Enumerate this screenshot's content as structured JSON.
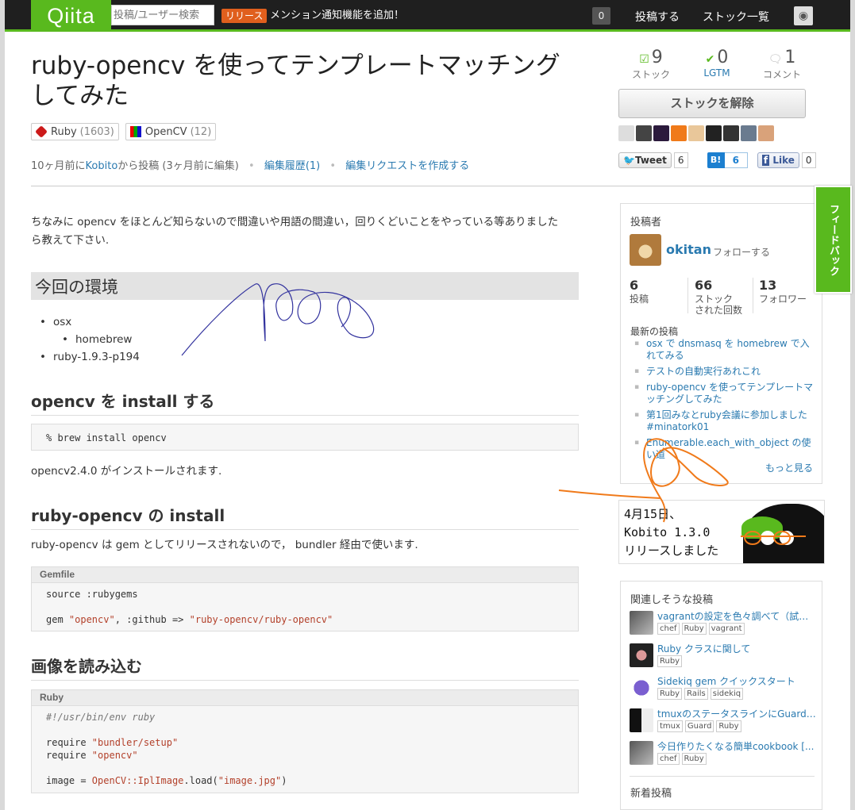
{
  "topbar": {
    "logo": "Qiita",
    "search_placeholder": "投稿/ユーザー検索",
    "release_tag": "リリース",
    "release_text": "メンション通知機能を追加！",
    "notification_count": "0",
    "nav_post": "投稿する",
    "nav_stock_list": "ストック一覧"
  },
  "article": {
    "title_line1": "ruby-opencv を使ってテンプレートマッチング",
    "title_line2": "してみた",
    "tags": [
      {
        "name": "Ruby",
        "count": "(1603)"
      },
      {
        "name": "OpenCV",
        "count": "(12)"
      }
    ],
    "meta_prefix": "10ヶ月前に",
    "meta_author_link": "Kobito",
    "meta_suffix": "から投稿 (3ヶ月前に編集)",
    "edit_history": "編集履歴(1)",
    "edit_request": "編集リクエストを作成する",
    "intro_line1": "ちなみに opencv をほとんど知らないので間違いや用語の間違い，回りくどいことをやっている等ありました",
    "intro_line2": "ら教えて下さい.",
    "h2_env": "今回の環境",
    "env_items": [
      "osx",
      "homebrew",
      "ruby-1.9.3-p194"
    ],
    "h3_install": "opencv を install する",
    "code_install": "% brew install opencv",
    "install_note": "opencv2.4.0 がインストールされます.",
    "h3_ruby_install": "ruby-opencv の install",
    "ruby_install_note": "ruby-opencv は gem としてリリースされないので， bundler 経由で使います.",
    "gemfile_label": "Gemfile",
    "gemfile_line1": "source :rubygems",
    "gemfile_line2_a": "gem ",
    "gemfile_line2_b": "\"opencv\"",
    "gemfile_line2_c": ", :github => ",
    "gemfile_line2_d": "\"ruby-opencv/ruby-opencv\"",
    "h3_load": "画像を読み込む",
    "ruby_label": "Ruby",
    "ruby_line1": "#!/usr/bin/env ruby",
    "ruby_req": "require ",
    "ruby_req1": "\"bundler/setup\"",
    "ruby_req2": "\"opencv\"",
    "ruby_img_a": "image = ",
    "ruby_img_b": "OpenCV::IplImage",
    "ruby_img_c": ".load(",
    "ruby_img_d": "\"image.jpg\"",
    "ruby_img_e": ")"
  },
  "stats": {
    "stock_count": "9",
    "stock_label": "ストック",
    "lgtm_count": "0",
    "lgtm_label": "LGTM",
    "comment_count": "1",
    "comment_label": "コメント",
    "unstock_button": "ストックを解除"
  },
  "social": {
    "tweet_label": "Tweet",
    "tweet_count": "6",
    "hatena_label": "B!",
    "hatena_count": "6",
    "like_label": "Like",
    "like_count": "0"
  },
  "author": {
    "header": "投稿者",
    "name": "okitan",
    "follow": "フォローする",
    "posts_n": "6",
    "posts_label": "投稿",
    "stocked_n": "66",
    "stocked_label1": "ストック",
    "stocked_label2": "された回数",
    "followers_n": "13",
    "followers_label": "フォロワー",
    "recent_header": "最新の投稿",
    "recent_items": [
      "osx で dnsmasq を homebrew で入れてみる",
      "テストの自動実行あれこれ",
      "ruby-opencv を使ってテンプレートマッチングしてみた",
      "第1回みなとruby会議に参加しました #minatork01",
      "Enumerable.each_with_object の使い道"
    ],
    "more": "もっと見る"
  },
  "banner": {
    "line1": "4月15日、",
    "line2": "Kobito 1.3.0",
    "line3": "リリースしました"
  },
  "related": {
    "header": "関連しそうな投稿",
    "items": [
      {
        "title": "vagrantの設定を色々調べて（試し…",
        "tags": [
          "chef",
          "Ruby",
          "vagrant"
        ]
      },
      {
        "title": "Ruby クラスに関して",
        "tags": [
          "Ruby"
        ]
      },
      {
        "title": "Sidekiq gem クイックスタート",
        "tags": [
          "Ruby",
          "Rails",
          "sidekiq"
        ]
      },
      {
        "title": "tmuxのステータスラインにGuard…",
        "tags": [
          "tmux",
          "Guard",
          "Ruby"
        ]
      },
      {
        "title": "今日作りたくなる簡単cookbook [...",
        "tags": [
          "chef",
          "Ruby"
        ]
      }
    ],
    "new_header": "新着投稿"
  },
  "feedback": "フィードバック",
  "colors": {
    "brand": "#59b91e",
    "link": "#2a7ab0",
    "release": "#e05f1d"
  }
}
